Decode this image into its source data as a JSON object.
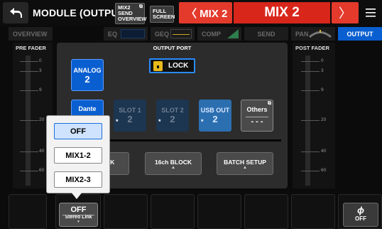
{
  "topbar": {
    "title": "MODULE (OUTPUT)",
    "mix_send_overview": [
      "MIX2",
      "SEND",
      "OVERVIEW"
    ],
    "full_screen": [
      "FULL",
      "SCREEN"
    ],
    "prev_label": "〈 MIX 2",
    "channel_name": "MIX 2",
    "next_label": "〉",
    "colors": {
      "channel": "#d9261b",
      "accent": "#0a5fd0"
    }
  },
  "tabs": {
    "overview": "OVERVIEW",
    "eq": "EQ",
    "geq": "GEQ",
    "comp": "COMP",
    "send": "SEND",
    "pan": "PAN",
    "output": "OUTPUT"
  },
  "pre_fader": {
    "title": "PRE FADER",
    "ticks": [
      "0",
      "3",
      "9",
      "20",
      "40",
      "60"
    ]
  },
  "post_fader": {
    "title": "POST FADER",
    "ticks": [
      "0",
      "3",
      "9",
      "20",
      "40",
      "60"
    ]
  },
  "output_port": {
    "title": "OUTPUT PORT",
    "lock": "LOCK",
    "analog": {
      "label": "ANALOG",
      "value": "2"
    },
    "dante": "Dante",
    "slot1": {
      "label": "SLOT 1",
      "value": "2"
    },
    "slot2": {
      "label": "SLOT 2",
      "value": "2"
    },
    "usb_out": {
      "label": "USB OUT",
      "value": "2"
    },
    "others": {
      "label": "Others",
      "value": "- - -"
    }
  },
  "blocks": {
    "left_partial": "CK",
    "block16": "16ch BLOCK",
    "batch_setup": "BATCH SETUP"
  },
  "popup": {
    "options": [
      "OFF",
      "MIX1-2",
      "MIX2-3"
    ],
    "selected": "OFF"
  },
  "stereo_link": {
    "value": "OFF",
    "label": "Stereo Link"
  },
  "phase": {
    "symbol": "ϕ",
    "value": "OFF"
  }
}
